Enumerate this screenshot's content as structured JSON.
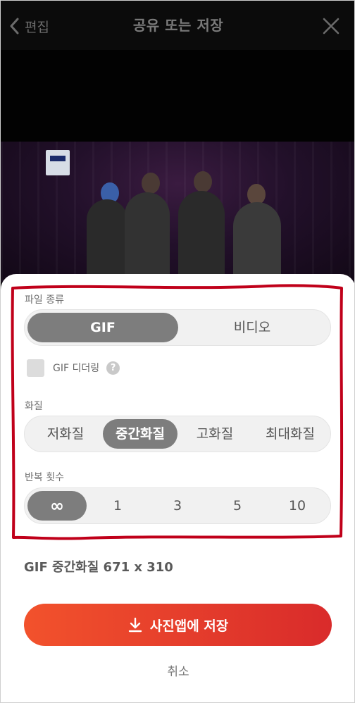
{
  "header": {
    "back_label": "편집",
    "title": "공유 또는 저장"
  },
  "file_type": {
    "label": "파일 종류",
    "options": [
      "GIF",
      "비디오"
    ],
    "selected": "GIF"
  },
  "dither": {
    "label": "GIF 디더링",
    "help": "?",
    "checked": false
  },
  "quality": {
    "label": "화질",
    "options": [
      "저화질",
      "중간화질",
      "고화질",
      "최대화질"
    ],
    "selected": "중간화질"
  },
  "repeat": {
    "label": "반복 횟수",
    "options": [
      "∞",
      "1",
      "3",
      "5",
      "10"
    ],
    "selected": "∞"
  },
  "summary": "GIF 중간화질 671 x 310",
  "save_label": "사진앱에 저장",
  "cancel_label": "취소",
  "colors": {
    "accent_start": "#f2522c",
    "accent_end": "#d92b2b",
    "annotation": "#c0001a"
  }
}
